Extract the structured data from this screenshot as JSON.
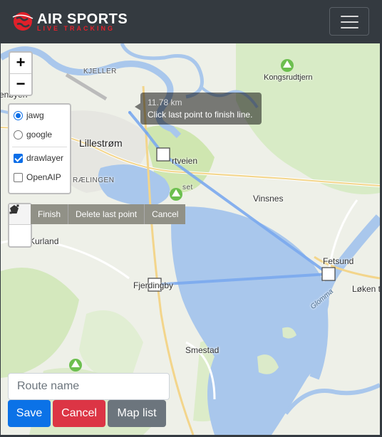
{
  "navbar": {
    "brand_title": "AIR SPORTS",
    "brand_subtitle": "LIVE TRACKING",
    "brand_color": "#e0202a",
    "menu_icon": "hamburger-icon"
  },
  "map": {
    "zoom_in": "+",
    "zoom_out": "−",
    "layers": {
      "base": [
        {
          "label": "jawg",
          "selected": true
        },
        {
          "label": "google",
          "selected": false
        }
      ],
      "overlays": [
        {
          "label": "drawlayer",
          "checked": true
        },
        {
          "label": "OpenAIP",
          "checked": false
        }
      ]
    },
    "draw_tools": {
      "polyline_icon": "polyline-icon",
      "polygon_icon": "polygon-icon"
    },
    "draw_actions": {
      "finish": "Finish",
      "delete_last": "Delete last point",
      "cancel": "Cancel"
    },
    "tooltip": {
      "distance": "11.78 km",
      "hint": "Click last point to finish line."
    },
    "places": {
      "kjeller": "KJELLER",
      "kongsrudtjern": "Kongsrudtjern",
      "lillestrom": "Lillestrøm",
      "veien": "rtveien",
      "aelingen": "RÆLINGEN",
      "vinsnes": "Vinsnes",
      "fetsund": "Fetsund",
      "loken": "Løken t",
      "glomma": "Glomma",
      "kurland": "Kurland",
      "fjerdingby": "Fjerdingby",
      "smestad": "Smestad",
      "enbyen": "enbyen",
      "set": "set"
    }
  },
  "form": {
    "route_name_placeholder": "Route name",
    "save": "Save",
    "cancel": "Cancel",
    "map_list": "Map list"
  },
  "colors": {
    "route_line": "#7aa8ee",
    "water": "#a9c7ec",
    "park": "#cfe6b0",
    "save": "#0b72e7",
    "cancel": "#dc3545",
    "maplist": "#6c757d"
  }
}
